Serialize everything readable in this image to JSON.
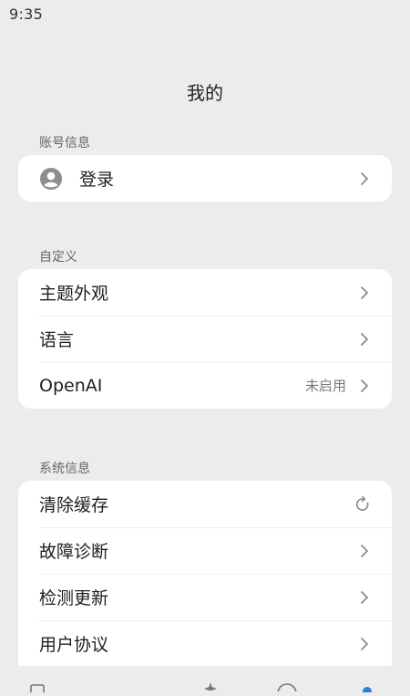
{
  "status_bar": {
    "time": "9:35"
  },
  "header": {
    "title": "我的"
  },
  "account": {
    "section_label": "账号信息",
    "login_label": "登录"
  },
  "customize": {
    "section_label": "自定义",
    "items": [
      {
        "label": "主题外观",
        "value": ""
      },
      {
        "label": "语言",
        "value": ""
      },
      {
        "label": "OpenAI",
        "value": "未启用"
      }
    ]
  },
  "system": {
    "section_label": "系统信息",
    "items": [
      {
        "label": "清除缓存",
        "icon": "refresh-icon"
      },
      {
        "label": "故障诊断",
        "icon": "chevron-right-icon"
      },
      {
        "label": "检测更新",
        "icon": "chevron-right-icon"
      },
      {
        "label": "用户协议",
        "icon": "chevron-right-icon"
      }
    ]
  },
  "icons": {
    "avatar": "user-avatar-icon",
    "chevron": "chevron-right-icon"
  },
  "colors": {
    "background": "#ececec",
    "card": "#ffffff",
    "text": "#1f1f1f",
    "secondary_text": "#666666"
  }
}
